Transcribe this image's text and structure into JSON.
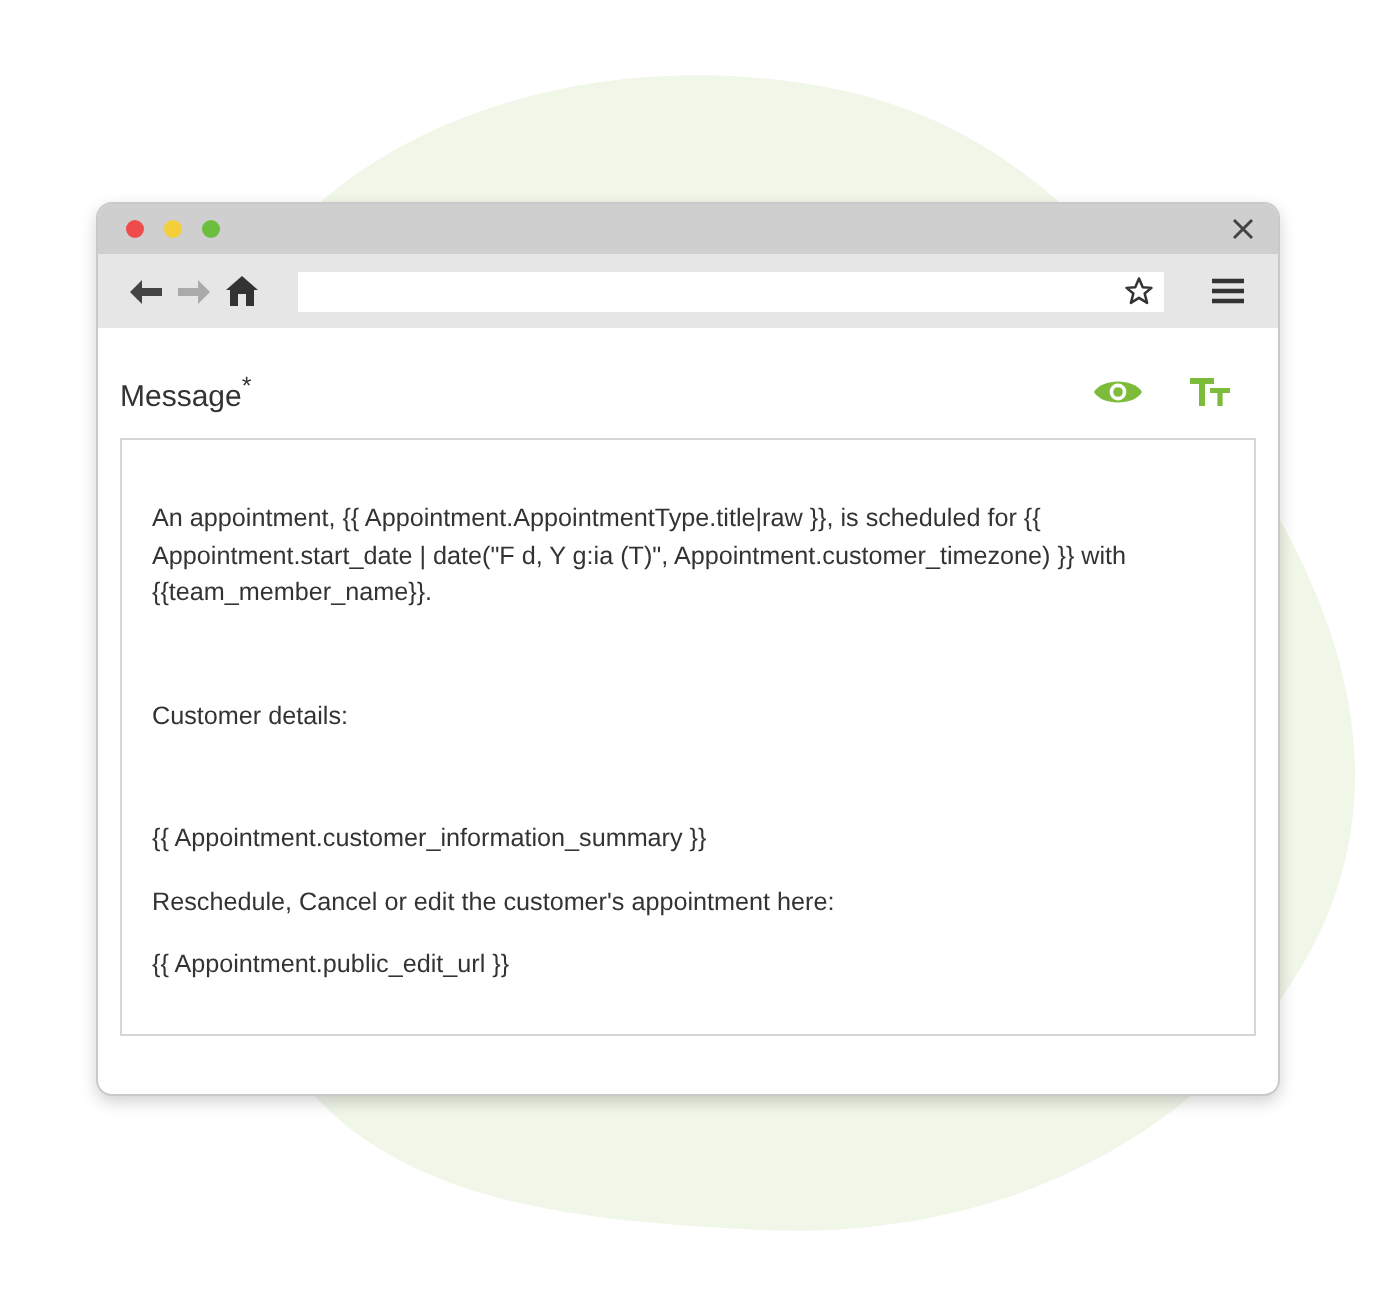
{
  "field": {
    "label": "Message$^{*}$"
  },
  "message": [
    "An appointment, {{ Appointment.AppointmentType.title|raw }}, is scheduled for {{ Appointment.start_date | date(\"F d, Y g:ia (T)\", Appointment.customer_timezone) }} with {{team_member_name}}.",
    "Customer details:",
    "{{ Appointment.customer_information_summary }}",
    "Reschedule, Cancel or edit the customer's appointment here:",
    "{{ Appointment.public_edit_url }}"
  ]
}
